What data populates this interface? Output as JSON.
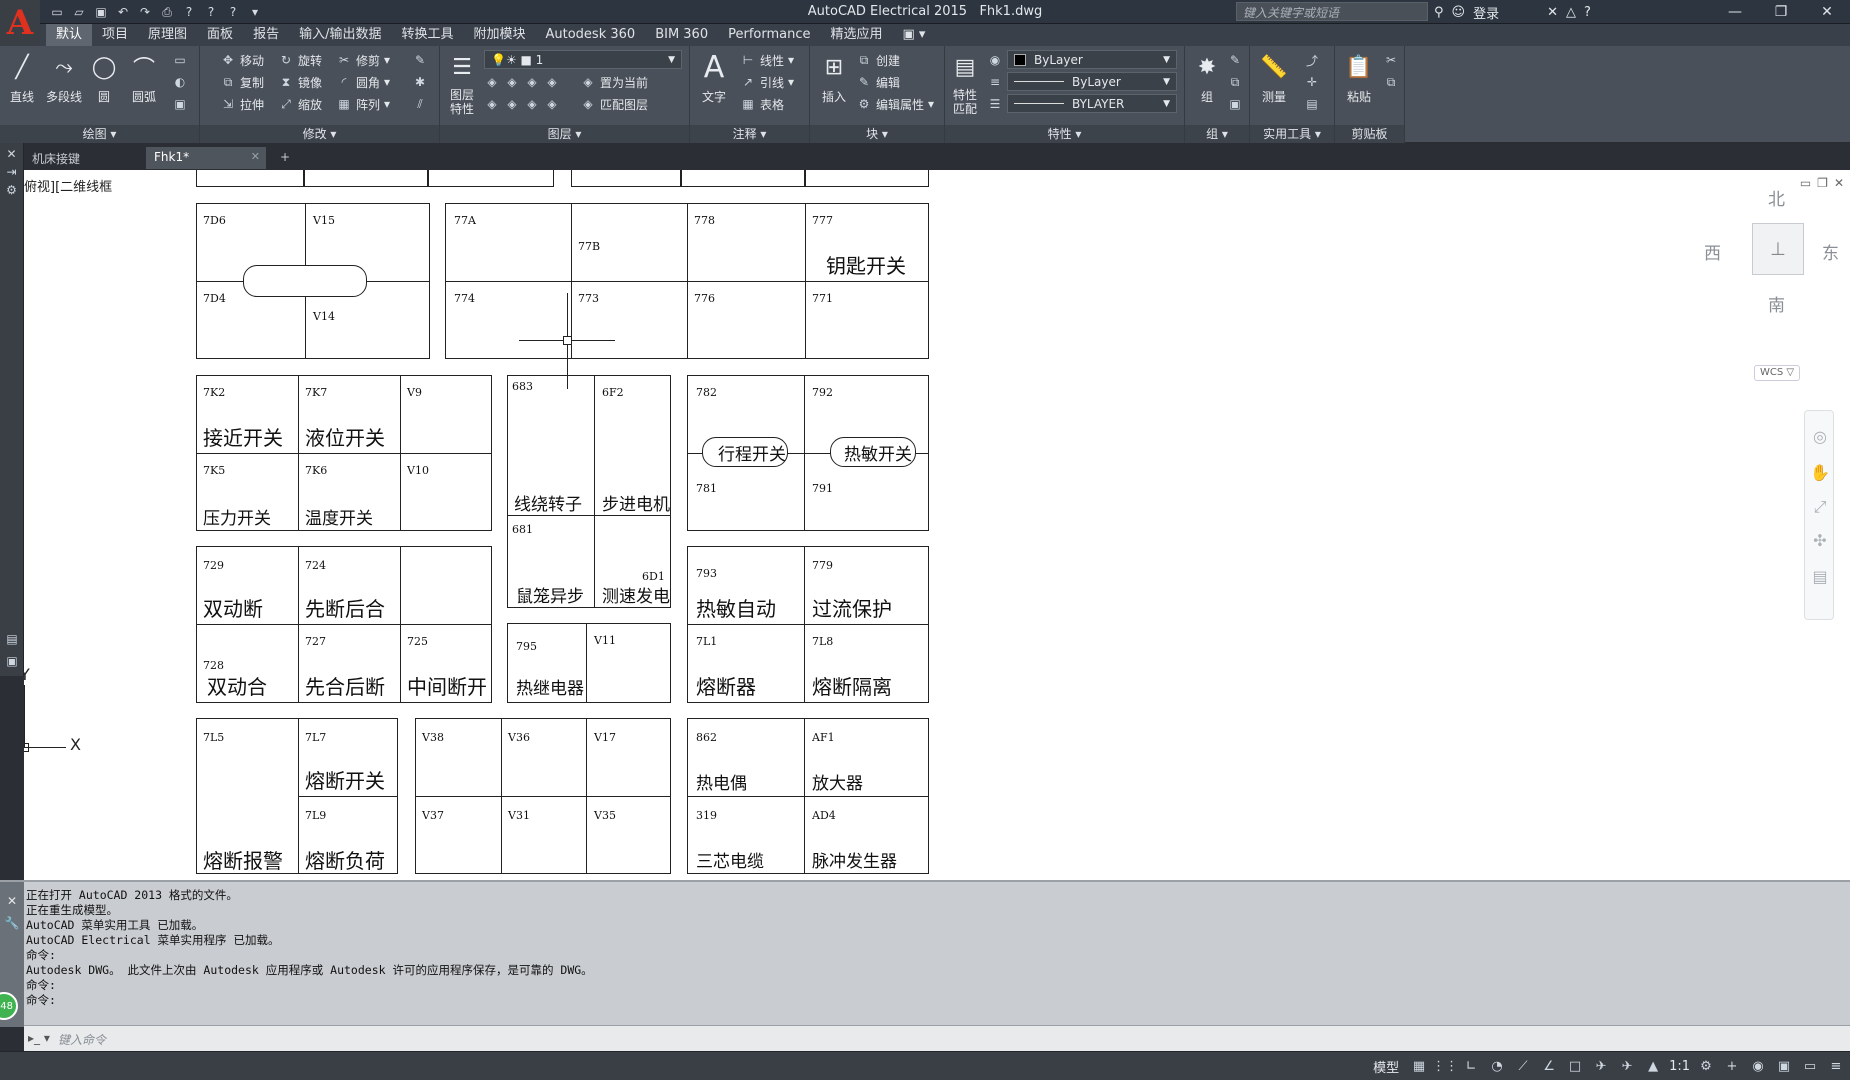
{
  "window": {
    "title": "AutoCAD Electrical 2015",
    "filename": "Fhk1.dwg",
    "search_placeholder": "键入关键字或短语",
    "login_label": "登录",
    "minimize": "—",
    "restore": "❐",
    "close": "✕"
  },
  "ribbon_tabs": [
    "默认",
    "项目",
    "原理图",
    "面板",
    "报告",
    "输入/输出数据",
    "转换工具",
    "附加模块",
    "Autodesk 360",
    "BIM 360",
    "Performance",
    "精选应用"
  ],
  "ribbon": {
    "draw": {
      "label": "绘图",
      "line": "直线",
      "polyline": "多段线",
      "circle": "圆",
      "arc": "圆弧"
    },
    "modify": {
      "label": "修改",
      "move": "移动",
      "rotate": "旋转",
      "trim": "修剪",
      "copy": "复制",
      "mirror": "镜像",
      "fillet": "圆角",
      "stretch": "拉伸",
      "scale": "缩放",
      "array": "阵列"
    },
    "layers": {
      "label": "图层",
      "layer_props": "图层\n特性",
      "current_layer": "1",
      "set_current": "置为当前",
      "match_layer": "匹配图层"
    },
    "annotation": {
      "label": "注释",
      "text": "文字",
      "linear": "线性",
      "leader": "引线",
      "table": "表格"
    },
    "block": {
      "label": "块",
      "insert": "插入",
      "create": "创建",
      "edit": "编辑",
      "edit_attr": "编辑属性"
    },
    "properties": {
      "label": "特性",
      "match": "特性\n匹配",
      "color": "ByLayer",
      "linetype": "ByLayer",
      "lineweight": "BYLAYER"
    },
    "groups": {
      "label": "组",
      "group": "组"
    },
    "utilities": {
      "label": "实用工具",
      "measure": "测量"
    },
    "clipboard": {
      "label": "剪贴板",
      "paste": "粘贴"
    }
  },
  "doc_tabs": [
    {
      "label": "机床接键",
      "active": false
    },
    {
      "label": "Fhk1*",
      "active": true
    }
  ],
  "viewport": {
    "label": "俯视][二维线框",
    "compass": {
      "north": "北",
      "south": "南",
      "east": "东",
      "west": "西"
    },
    "wcs": "WCS ▽",
    "ucs_x": "X",
    "ucs_y": "Y"
  },
  "drawing": {
    "g1": {
      "c1": "7D6",
      "c2": "V15",
      "c3": "7D4",
      "c4": "V14"
    },
    "g2": {
      "c1": "77A",
      "c2": "77B",
      "c3": "778",
      "c4": "777",
      "l4": "钥匙开关",
      "c5": "774",
      "c6": "773",
      "c7": "776",
      "c8": "771"
    },
    "g3": {
      "c1": "7K2",
      "l1": "接近开关",
      "c2": "7K7",
      "l2": "液位开关",
      "c3": "V9",
      "c4": "7K5",
      "l4": "压力开关",
      "c5": "7K6",
      "l5": "温度开关",
      "c6": "V10"
    },
    "g4": {
      "c1": "683",
      "c2": "6F2",
      "l1": "线绕转子",
      "l2": "步进电机",
      "c3": "681",
      "c4": "6D1",
      "l3": "鼠笼异步",
      "l4": "测速发电"
    },
    "g5": {
      "c1": "782",
      "c2": "792",
      "l1": "行程开关",
      "l2": "热敏开关",
      "c3": "781",
      "c4": "791"
    },
    "g6": {
      "c1": "729",
      "l1": "双动断",
      "c2": "724",
      "l2": "先断后合",
      "c3": "728",
      "l3": "双动合",
      "c4": "727",
      "l4": "先合后断",
      "c5": "725",
      "l5": "中间断开"
    },
    "g7": {
      "c1": "795",
      "c2": "V11",
      "l1": "热继电器"
    },
    "g8": {
      "c1": "793",
      "l1": "热敏自动",
      "c2": "779",
      "l2": "过流保护",
      "c3": "7L1",
      "l3": "熔断器",
      "c4": "7L8",
      "l4": "熔断隔离"
    },
    "g9": {
      "c1": "7L5",
      "l1": "熔断报警",
      "c2": "7L7",
      "l2": "熔断开关",
      "c3": "7L9",
      "l3": "熔断负荷"
    },
    "g10": {
      "c1": "V38",
      "c2": "V36",
      "c3": "V17",
      "c4": "V37",
      "c5": "V31",
      "c6": "V35"
    },
    "g11": {
      "c1": "862",
      "l1": "热电偶",
      "c2": "AF1",
      "l2": "放大器",
      "c3": "319",
      "l3": "三芯电缆",
      "c4": "AD4",
      "l4": "脉冲发生器"
    }
  },
  "command": {
    "history": [
      "正在打开 AutoCAD 2013 格式的文件。",
      "正在重生成模型。",
      "AutoCAD 菜单实用工具 已加载。",
      "AutoCAD Electrical 菜单实用程序 已加载。",
      "命令:",
      "Autodesk DWG。 此文件上次由 Autodesk 应用程序或 Autodesk 许可的应用程序保存，是可靠的 DWG。",
      "命令:",
      "命令:"
    ],
    "input_placeholder": "键入命令",
    "badge": "48"
  },
  "status": {
    "model": "模型",
    "scale": "1:1"
  }
}
